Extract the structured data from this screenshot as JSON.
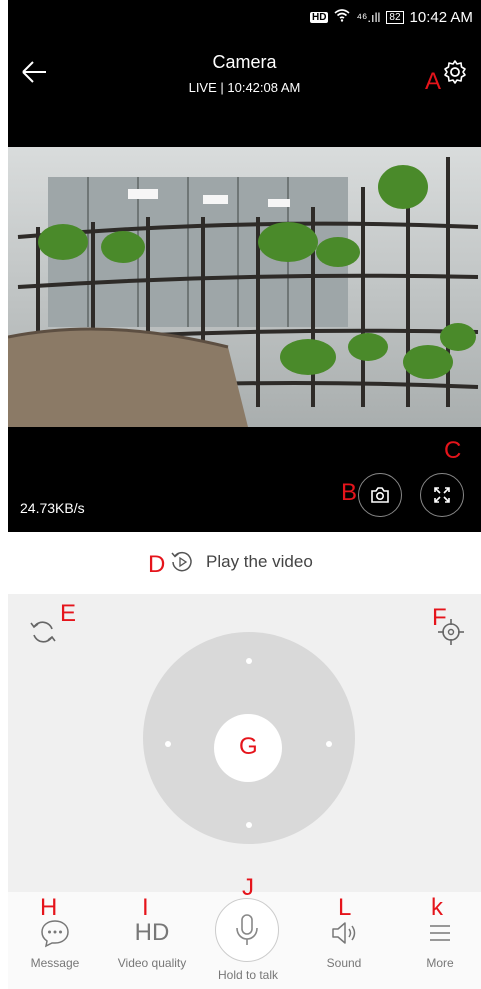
{
  "status_bar": {
    "hd_badge": "HD",
    "signal": "⁴⁶.ıll",
    "battery": "82",
    "time": "10:42 AM"
  },
  "header": {
    "title": "Camera",
    "subtitle": "LIVE | 10:42:08 AM"
  },
  "video": {
    "bitrate": "24.73KB/s"
  },
  "annotations": {
    "A": "A",
    "B": "B",
    "C": "C",
    "D": "D",
    "E": "E",
    "F": "F",
    "G": "G",
    "H": "H",
    "I": "I",
    "J": "J",
    "L": "L",
    "K": "k"
  },
  "playback": {
    "label": "Play the video"
  },
  "bottom_nav": {
    "message": "Message",
    "video_quality": "Video quality",
    "video_quality_icon": "HD",
    "hold_to_talk": "Hold to talk",
    "sound": "Sound",
    "more": "More"
  },
  "colors": {
    "annotation_red": "#e5141b",
    "topbar_bg": "#000000",
    "control_bg": "#f0f0f0",
    "joystick_bg": "#d9d9d9"
  }
}
